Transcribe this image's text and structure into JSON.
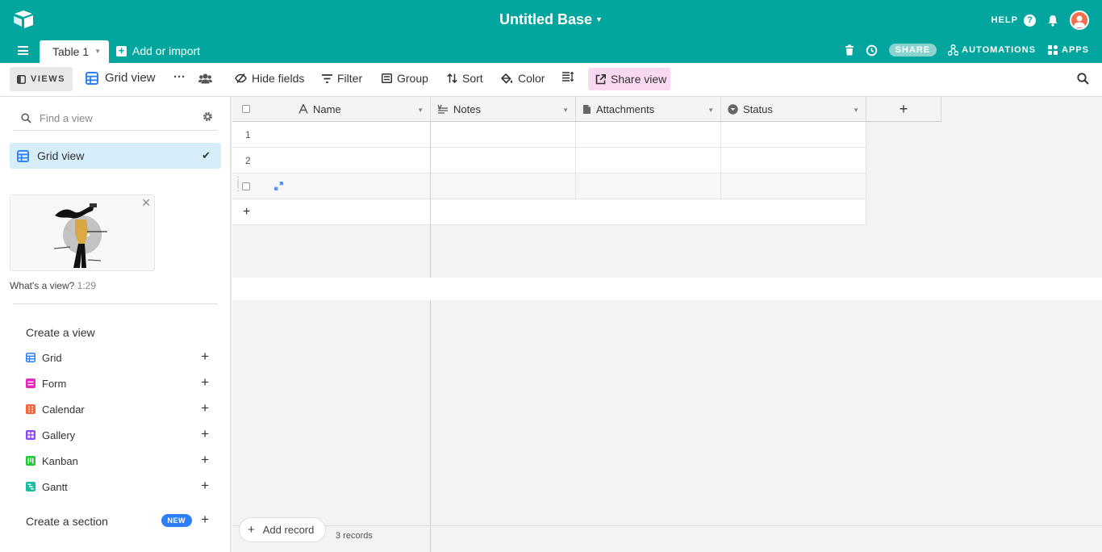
{
  "app": {
    "base_title": "Untitled Base",
    "help": "HELP",
    "help_icon_glyph": "?",
    "accent": "#02a69f"
  },
  "tabs": {
    "active": "Table 1",
    "add_or_import": "Add or import"
  },
  "header_actions": {
    "share": "SHARE",
    "automations": "AUTOMATIONS",
    "apps": "APPS"
  },
  "toolbar": {
    "views": "VIEWS",
    "current_view": "Grid view",
    "hide_fields": "Hide fields",
    "filter": "Filter",
    "group": "Group",
    "sort": "Sort",
    "color": "Color",
    "share_view": "Share view"
  },
  "sidebar": {
    "find_placeholder": "Find a view",
    "active_view": "Grid view",
    "video_caption": "What's a view?",
    "video_duration": "1:29",
    "create_view_title": "Create a view",
    "view_types": [
      {
        "label": "Grid",
        "color": "#2d7ff9"
      },
      {
        "label": "Form",
        "color": "#e929ba"
      },
      {
        "label": "Calendar",
        "color": "#f7653b"
      },
      {
        "label": "Gallery",
        "color": "#8b46ff"
      },
      {
        "label": "Kanban",
        "color": "#20c933"
      },
      {
        "label": "Gantt",
        "color": "#18bfa3"
      }
    ],
    "create_section": "Create a section",
    "new_badge": "NEW"
  },
  "grid": {
    "columns": [
      "Name",
      "Notes",
      "Attachments",
      "Status"
    ],
    "rows": [
      "1",
      "2",
      ""
    ],
    "add_record": "Add record",
    "records_count": "3 records"
  }
}
